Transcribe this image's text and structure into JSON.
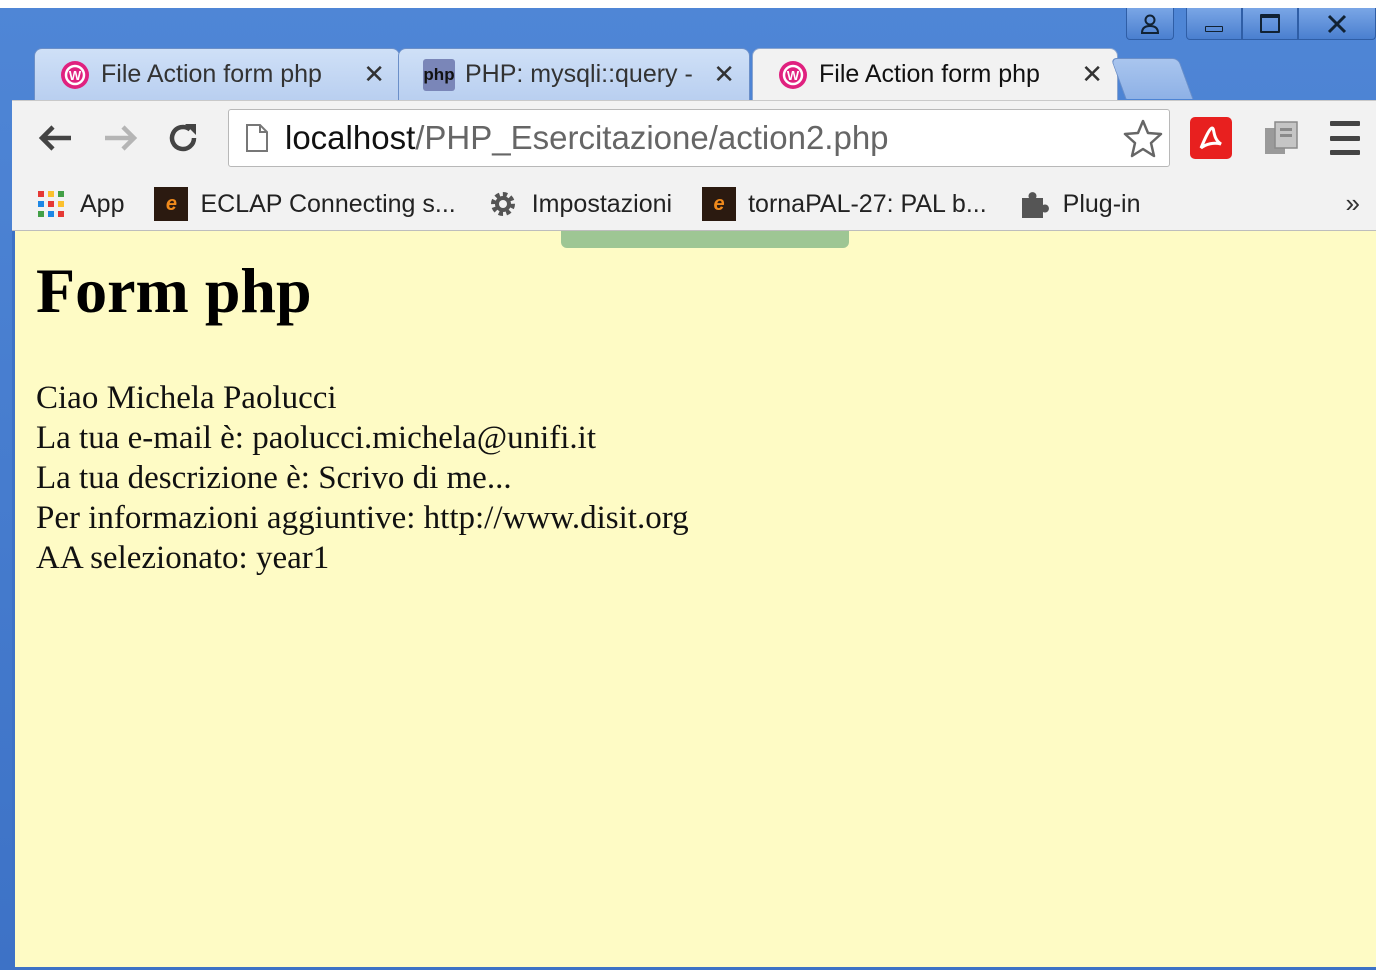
{
  "tabs": [
    {
      "title": "File Action form php",
      "close": "✕",
      "favicon": "wamp-icon",
      "active": false
    },
    {
      "title": "PHP: mysqli::query -",
      "close": "✕",
      "favicon": "php-icon",
      "favicon_text": "php",
      "active": false
    },
    {
      "title": "File Action form php",
      "close": "✕",
      "favicon": "wamp-icon",
      "active": true
    }
  ],
  "address_bar": {
    "host": "localhost",
    "path": "/PHP_Esercitazione/action2.php"
  },
  "bookmarks": [
    {
      "label": "App",
      "icon": "apps-grid-icon"
    },
    {
      "label": "ECLAP Connecting s...",
      "icon": "eclap-icon"
    },
    {
      "label": "Impostazioni",
      "icon": "gear-icon"
    },
    {
      "label": "tornaPAL-27: PAL b...",
      "icon": "eclap-icon"
    },
    {
      "label": "Plug-in",
      "icon": "puzzle-icon"
    }
  ],
  "bookmarks_overflow": "»",
  "page": {
    "heading": "Form php",
    "lines": [
      "Ciao Michela Paolucci",
      "La tua e-mail è: paolucci.michela@unifi.it",
      "La tua descrizione è: Scrivo di me...",
      "Per informazioni aggiuntive: http://www.disit.org",
      "AA selezionato: year1"
    ]
  },
  "colors": {
    "page_background": "#fefbc5",
    "window_frame": "#3d72c6",
    "acrobat_red": "#e8201f",
    "wamp_pink": "#e0217f"
  }
}
